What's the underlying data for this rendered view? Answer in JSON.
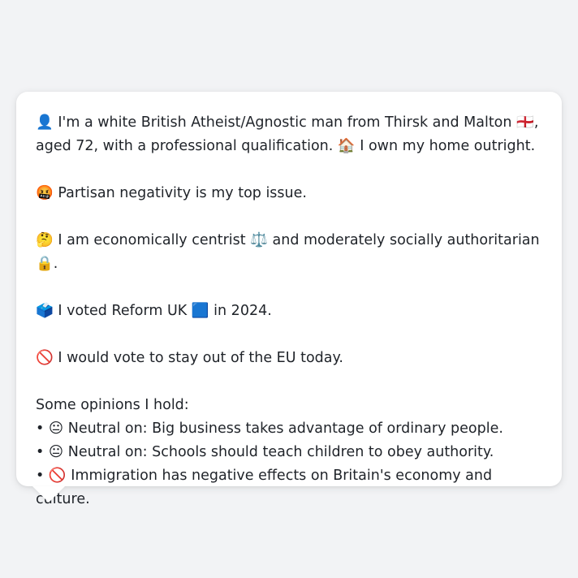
{
  "post": {
    "intro_icon": "👤",
    "intro_text": "I'm a white British Atheist/Agnostic man from Thirsk and Malton 🏴󠁧󠁢󠁥󠁮󠁧󠁿, aged 72, with a professional qualification. 🏠 I own my home outright.",
    "issue_icon": "🤬",
    "issue_text": "Partisan negativity is my top issue.",
    "ideology_icon": "🤔",
    "ideology_text": "I am economically centrist ⚖️ and moderately socially authoritarian 🔒.",
    "vote_icon": "🗳️",
    "vote_text": "I voted Reform UK 🟦 in 2024.",
    "eu_icon": "🚫",
    "eu_text": "I would vote to stay out of the EU today.",
    "opinions_heading": "Some opinions I hold:",
    "opinions": [
      {
        "bullet": "•",
        "icon": "😐",
        "text": "Neutral on: Big business takes advantage of ordinary people."
      },
      {
        "bullet": "•",
        "icon": "😐",
        "text": "Neutral on: Schools should teach children to obey authority."
      },
      {
        "bullet": "•",
        "icon": "🚫",
        "text": "Immigration has negative effects on Britain's economy and culture."
      }
    ]
  }
}
